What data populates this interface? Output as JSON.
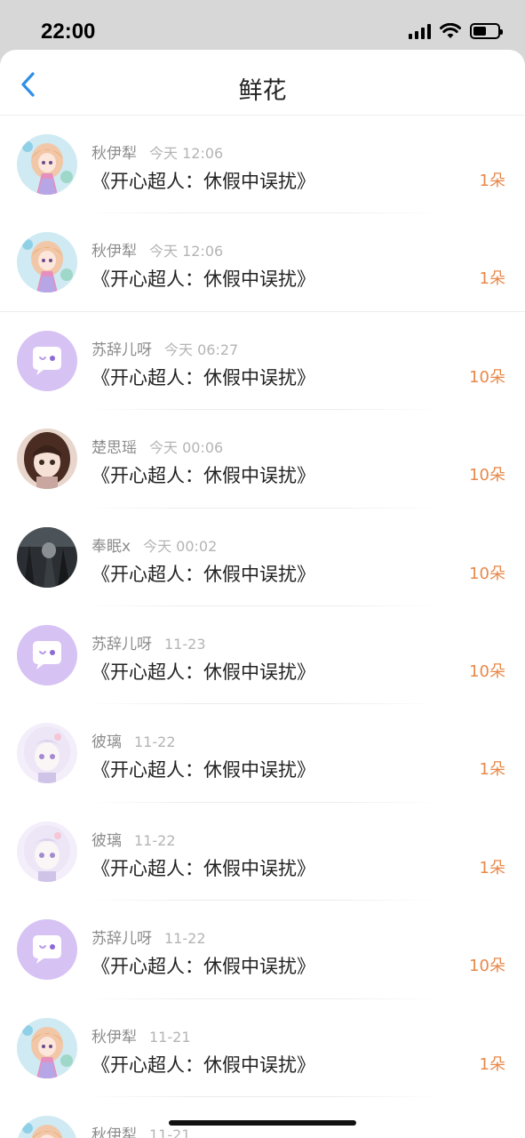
{
  "status_bar": {
    "time": "22:00"
  },
  "nav": {
    "title": "鲜花"
  },
  "colors": {
    "accent": "#2f8fe8",
    "count": "#e8884a",
    "avatar_placeholder": "#d7c2f4"
  },
  "rows": [
    {
      "name": "秋伊犁",
      "time": "今天 12:06",
      "gift": "《开心超人：休假中误扰》",
      "count": "1朵",
      "avatar": "anime-girl-pink"
    },
    {
      "name": "秋伊犁",
      "time": "今天 12:06",
      "gift": "《开心超人：休假中误扰》",
      "count": "1朵",
      "avatar": "anime-girl-pink"
    },
    {
      "name": "苏辞儿呀",
      "time": "今天 06:27",
      "gift": "《开心超人：休假中误扰》",
      "count": "10朵",
      "avatar": "chat-bubble-default"
    },
    {
      "name": "楚思瑶",
      "time": "今天 00:06",
      "gift": "《开心超人：休假中误扰》",
      "count": "10朵",
      "avatar": "anime-girl-brown"
    },
    {
      "name": "奉眠x",
      "time": "今天 00:02",
      "gift": "《开心超人：休假中误扰》",
      "count": "10朵",
      "avatar": "dark-figure"
    },
    {
      "name": "苏辞儿呀",
      "time": "11-23",
      "gift": "《开心超人：休假中误扰》",
      "count": "10朵",
      "avatar": "chat-bubble-default"
    },
    {
      "name": "彼璃",
      "time": "11-22",
      "gift": "《开心超人：休假中误扰》",
      "count": "1朵",
      "avatar": "anime-girl-white"
    },
    {
      "name": "彼璃",
      "time": "11-22",
      "gift": "《开心超人：休假中误扰》",
      "count": "1朵",
      "avatar": "anime-girl-white"
    },
    {
      "name": "苏辞儿呀",
      "time": "11-22",
      "gift": "《开心超人：休假中误扰》",
      "count": "10朵",
      "avatar": "chat-bubble-default"
    },
    {
      "name": "秋伊犁",
      "time": "11-21",
      "gift": "《开心超人：休假中误扰》",
      "count": "1朵",
      "avatar": "anime-girl-pink"
    },
    {
      "name": "秋伊犁",
      "time": "11-21",
      "gift": "",
      "count": "",
      "avatar": "anime-girl-pink"
    }
  ]
}
